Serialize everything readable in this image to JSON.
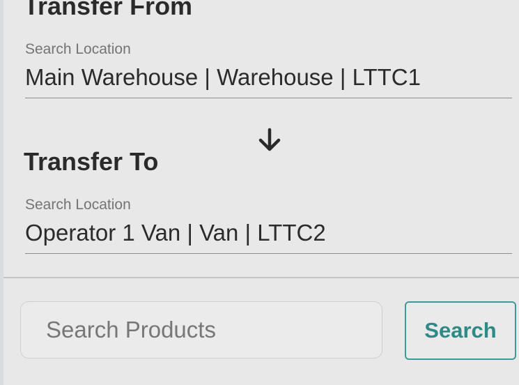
{
  "transfer_from": {
    "title": "Transfer From",
    "label": "Search Location",
    "value": "Main Warehouse | Warehouse | LTTC1"
  },
  "transfer_to": {
    "title": "Transfer To",
    "label": "Search Location",
    "value": "Operator 1 Van | Van | LTTC2"
  },
  "direction_icon": "arrow-down-icon",
  "product_search": {
    "placeholder": "Search Products",
    "value": "",
    "button_label": "Search"
  },
  "colors": {
    "accent": "#3f9a95",
    "background": "#e8e8e8",
    "text": "#2b2b2b",
    "label": "#747474"
  }
}
